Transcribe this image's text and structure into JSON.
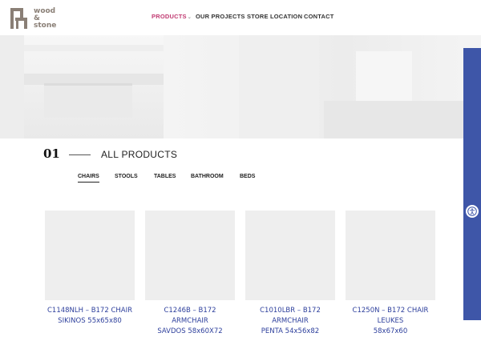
{
  "brand": {
    "logo_top": "wood",
    "logo_amp": "&",
    "logo_bottom": "stone"
  },
  "nav": {
    "items": [
      {
        "label": "PRODUCTS",
        "has_dropdown": true,
        "active": true
      },
      {
        "label": "OUR PROJECTS"
      },
      {
        "label": "STORE LOCATION"
      },
      {
        "label": "CONTACT"
      }
    ]
  },
  "section": {
    "number": "01",
    "title": "ALL PRODUCTS"
  },
  "tabs": [
    {
      "label": "CHAIRS",
      "active": true
    },
    {
      "label": "STOOLS"
    },
    {
      "label": "TABLES"
    },
    {
      "label": "BATHROOM"
    },
    {
      "label": "BEDS"
    }
  ],
  "products": [
    {
      "name_line1": "C1148NLH – B172 CHAIR",
      "name_line2": "SIKINOS 55x65x80"
    },
    {
      "name_line1": "C1246B – B172 ARMCHAIR",
      "name_line2": "SAVDOS 58x60X72"
    },
    {
      "name_line1": "C1010LBR – B172 ARMCHAIR",
      "name_line2": "PENTA 54x56x82"
    },
    {
      "name_line1": "C1250N – B172 CHAIR LEUKES",
      "name_line2": "58x67x60"
    }
  ],
  "colors": {
    "accent_nav": "#c13b72",
    "product_title": "#2d3f9c",
    "sidetab": "#3e56a8"
  },
  "icons": {
    "accessibility": "accessibility-icon",
    "dropdown": "chevron-down-icon"
  }
}
